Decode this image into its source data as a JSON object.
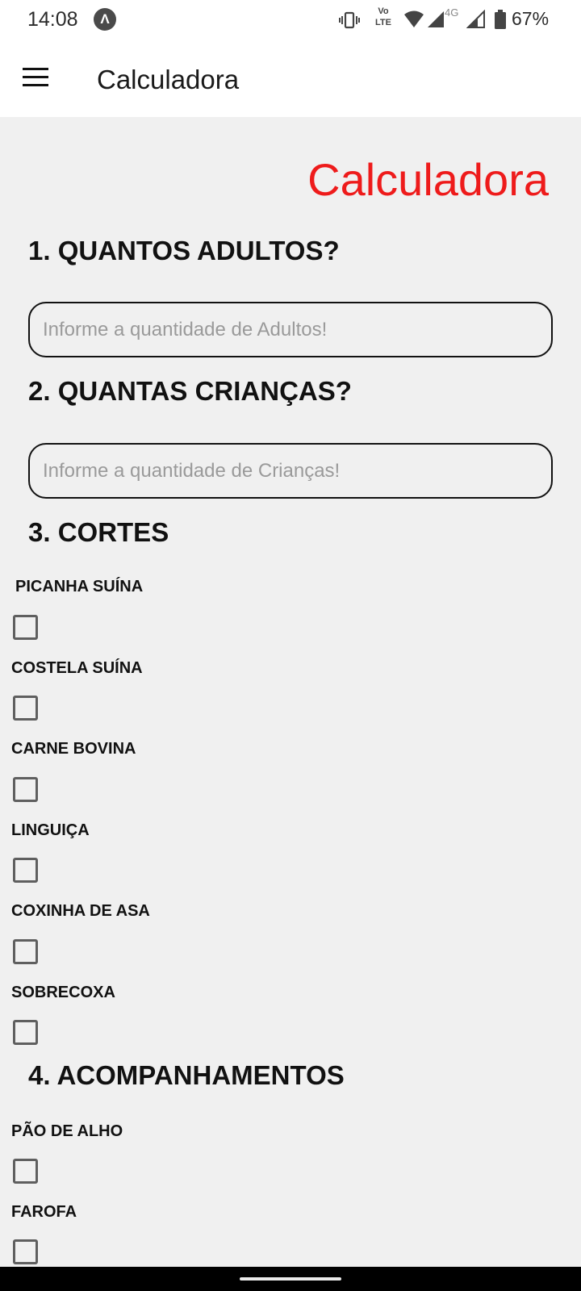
{
  "status_bar": {
    "time": "14:08",
    "app_badge": "Λ",
    "volte_label": "Vo\nLTE",
    "network_type": "4G",
    "battery": "67%",
    "icons": [
      "vibrate-icon",
      "volte-icon",
      "wifi-icon",
      "signal-icon",
      "signal-icon",
      "battery-icon"
    ]
  },
  "app_bar": {
    "title": "Calculadora",
    "menu_icon": "hamburger-menu-icon"
  },
  "main": {
    "page_title": "Calculadora",
    "page_title_color": "#ee1b1b",
    "section_adults": {
      "heading": "1. QUANTOS ADULTOS?",
      "input_value": "",
      "input_placeholder": "Informe a quantidade de Adultos!"
    },
    "section_children": {
      "heading": "2. QUANTAS CRIANÇAS?",
      "input_value": "",
      "input_placeholder": "Informe a quantidade de Crianças!"
    },
    "section_cuts": {
      "heading": "3. CORTES",
      "items": [
        {
          "label": "PICANHA SUÍNA",
          "checked": false
        },
        {
          "label": "COSTELA SUÍNA",
          "checked": false
        },
        {
          "label": "CARNE BOVINA",
          "checked": false
        },
        {
          "label": "LINGUIÇA",
          "checked": false
        },
        {
          "label": "COXINHA DE ASA",
          "checked": false
        },
        {
          "label": "SOBRECOXA",
          "checked": false
        }
      ]
    },
    "section_sides": {
      "heading": "4. ACOMPANHAMENTOS",
      "items": [
        {
          "label": "PÃO DE ALHO",
          "checked": false
        },
        {
          "label": "FAROFA",
          "checked": false
        }
      ]
    }
  }
}
